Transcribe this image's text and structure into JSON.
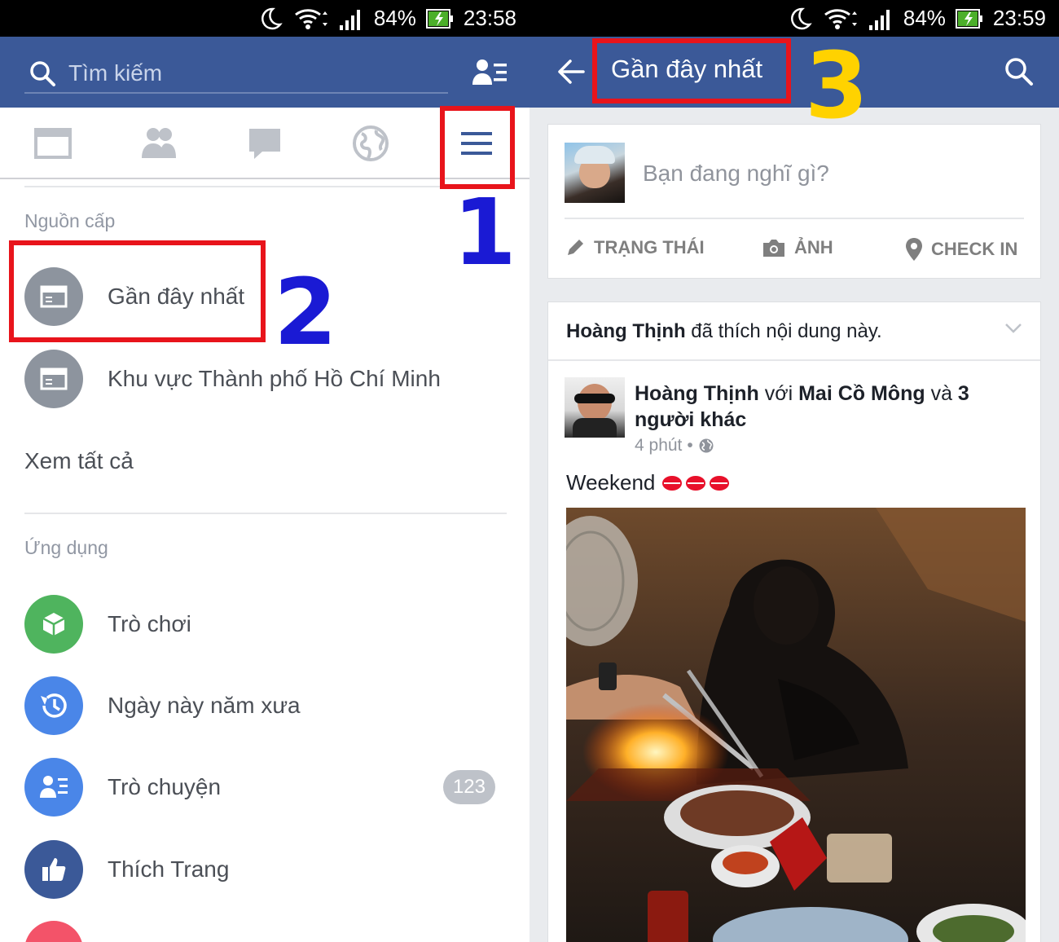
{
  "left": {
    "status": {
      "battery": "84%",
      "time": "23:58"
    },
    "search": {
      "placeholder": "Tìm kiếm"
    },
    "sections": {
      "feeds": "Nguồn cấp",
      "apps": "Ứng dụng"
    },
    "feeds": [
      {
        "label": "Gần đây nhất",
        "icon": "newsfeed-icon"
      },
      {
        "label": "Khu vực Thành phố Hồ Chí Minh",
        "icon": "newsfeed-icon"
      }
    ],
    "see_all": "Xem tất cả",
    "apps": [
      {
        "label": "Trò chơi",
        "icon": "games-icon",
        "color": "#4fb45e"
      },
      {
        "label": "Ngày này năm xưa",
        "icon": "history-icon",
        "color": "#4a86e8"
      },
      {
        "label": "Trò chuyện",
        "icon": "chat-icon",
        "color": "#4a86e8",
        "badge": "123"
      },
      {
        "label": "Thích Trang",
        "icon": "like-icon",
        "color": "#3b5998"
      }
    ],
    "annotations": {
      "n1": "1",
      "n2": "2"
    }
  },
  "right": {
    "status": {
      "battery": "84%",
      "time": "23:59"
    },
    "title": "Gần đây nhất",
    "composer": {
      "prompt": "Bạn đang nghĩ gì?",
      "actions": {
        "status": "TRẠNG THÁI",
        "photo": "ẢNH",
        "checkin": "CHECK IN"
      }
    },
    "story": {
      "liker": "Hoàng Thịnh",
      "action": " đã thích nội dung này.",
      "author": "Hoàng Thịnh",
      "with": " với ",
      "tagged": "Mai Cồ Mông",
      "and": " và ",
      "others": "3 người khác",
      "time": "4 phút",
      "dot": "•",
      "text": "Weekend"
    },
    "annotations": {
      "n3": "3"
    }
  },
  "colors": {
    "fb_blue": "#3b5998",
    "highlight_red": "#e8141b",
    "number_blue": "#1a1ad4",
    "number_yellow": "#ffd200"
  }
}
